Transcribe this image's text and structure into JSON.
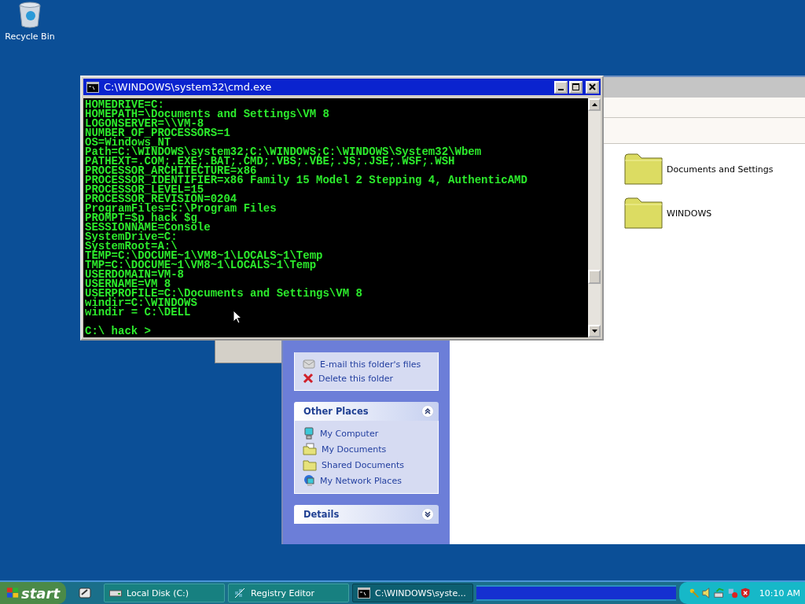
{
  "desktop_icons": [
    {
      "label": "Recycle Bin"
    }
  ],
  "explorer": {
    "tasks_panel": {
      "items": [
        {
          "label": "E-mail this folder's files",
          "kind": "email"
        },
        {
          "label": "Delete this folder",
          "kind": "delete"
        }
      ]
    },
    "panels": [
      {
        "title": "Other Places",
        "expanded": true,
        "items": [
          {
            "label": "My Computer",
            "kind": "computer"
          },
          {
            "label": "My Documents",
            "kind": "documents"
          },
          {
            "label": "Shared Documents",
            "kind": "folder"
          },
          {
            "label": "My Network Places",
            "kind": "network"
          }
        ]
      },
      {
        "title": "Details",
        "expanded": false
      }
    ],
    "folders": [
      {
        "label": "Documents and Settings"
      },
      {
        "label": "WINDOWS"
      }
    ]
  },
  "cmd_window": {
    "title": "C:\\WINDOWS\\system32\\cmd.exe",
    "lines": [
      "HOMEDRIVE=C:",
      "HOMEPATH=\\Documents and Settings\\VM 8",
      "LOGONSERVER=\\\\VM-8",
      "NUMBER_OF_PROCESSORS=1",
      "OS=Windows_NT",
      "Path=C:\\WINDOWS\\system32;C:\\WINDOWS;C:\\WINDOWS\\System32\\Wbem",
      "PATHEXT=.COM;.EXE;.BAT;.CMD;.VBS;.VBE;.JS;.JSE;.WSF;.WSH",
      "PROCESSOR_ARCHITECTURE=x86",
      "PROCESSOR_IDENTIFIER=x86 Family 15 Model 2 Stepping 4, AuthenticAMD",
      "PROCESSOR_LEVEL=15",
      "PROCESSOR_REVISION=0204",
      "ProgramFiles=C:\\Program Files",
      "PROMPT=$p hack $g",
      "SESSIONNAME=Console",
      "SystemDrive=C:",
      "SystemRoot=A:\\",
      "TEMP=C:\\DOCUME~1\\VM8~1\\LOCALS~1\\Temp",
      "TMP=C:\\DOCUME~1\\VM8~1\\LOCALS~1\\Temp",
      "USERDOMAIN=VM-8",
      "USERNAME=VM 8",
      "USERPROFILE=C:\\Documents and Settings\\VM 8",
      "windir=C:\\WINDOWS",
      "windir = C:\\DELL"
    ],
    "prompt": "C:\\ hack >"
  },
  "taskbar": {
    "start": "start",
    "tasks": [
      {
        "label": "Local Disk (C:)",
        "kind": "drive",
        "selected": false
      },
      {
        "label": "Registry Editor",
        "kind": "registry",
        "selected": false
      },
      {
        "label": "C:\\WINDOWS\\syste...",
        "kind": "console",
        "selected": true
      }
    ],
    "clock": "10:10 AM"
  }
}
